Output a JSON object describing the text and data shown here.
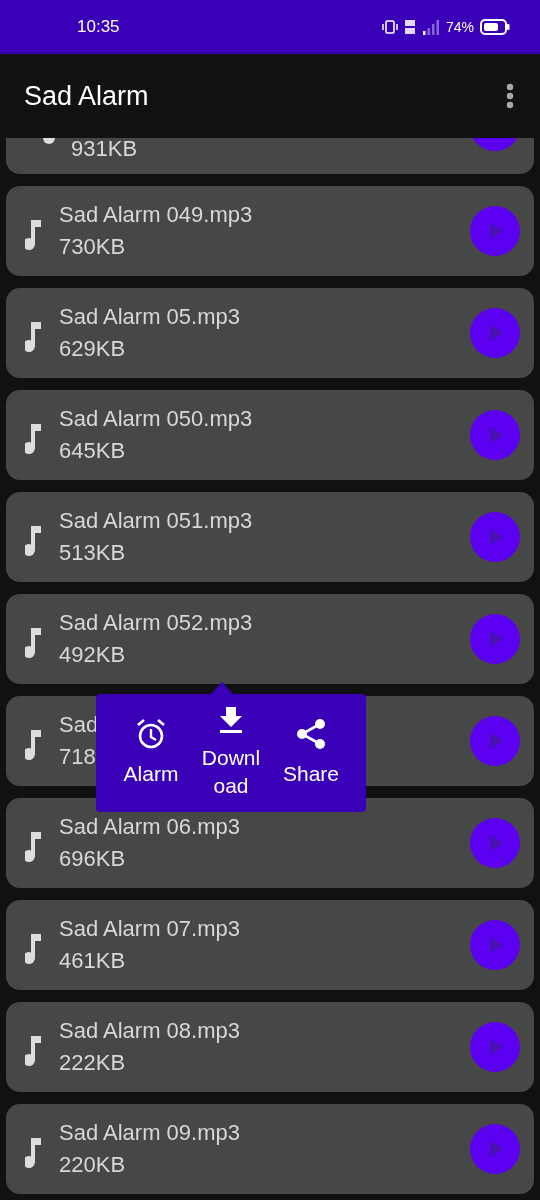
{
  "status_bar": {
    "time": "10:35",
    "battery": "74%"
  },
  "app_bar": {
    "title": "Sad Alarm"
  },
  "files": [
    {
      "size": "931KB"
    },
    {
      "name": "Sad Alarm 049.mp3",
      "size": "730KB"
    },
    {
      "name": "Sad Alarm 05.mp3",
      "size": "629KB"
    },
    {
      "name": "Sad Alarm 050.mp3",
      "size": "645KB"
    },
    {
      "name": "Sad Alarm 051.mp3",
      "size": "513KB"
    },
    {
      "name": "Sad Alarm 052.mp3",
      "size": "492KB"
    },
    {
      "name": "Sad",
      "size": "718"
    },
    {
      "name": "Sad Alarm 06.mp3",
      "size": "696KB"
    },
    {
      "name": "Sad Alarm 07.mp3",
      "size": "461KB"
    },
    {
      "name": "Sad Alarm 08.mp3",
      "size": "222KB"
    },
    {
      "name": "Sad Alarm 09.mp3",
      "size": "220KB"
    }
  ],
  "popup_menu": {
    "items": [
      {
        "kind": "alarm",
        "label": "Alarm"
      },
      {
        "kind": "download",
        "label": "Download"
      },
      {
        "kind": "share",
        "label": "Share"
      }
    ]
  }
}
